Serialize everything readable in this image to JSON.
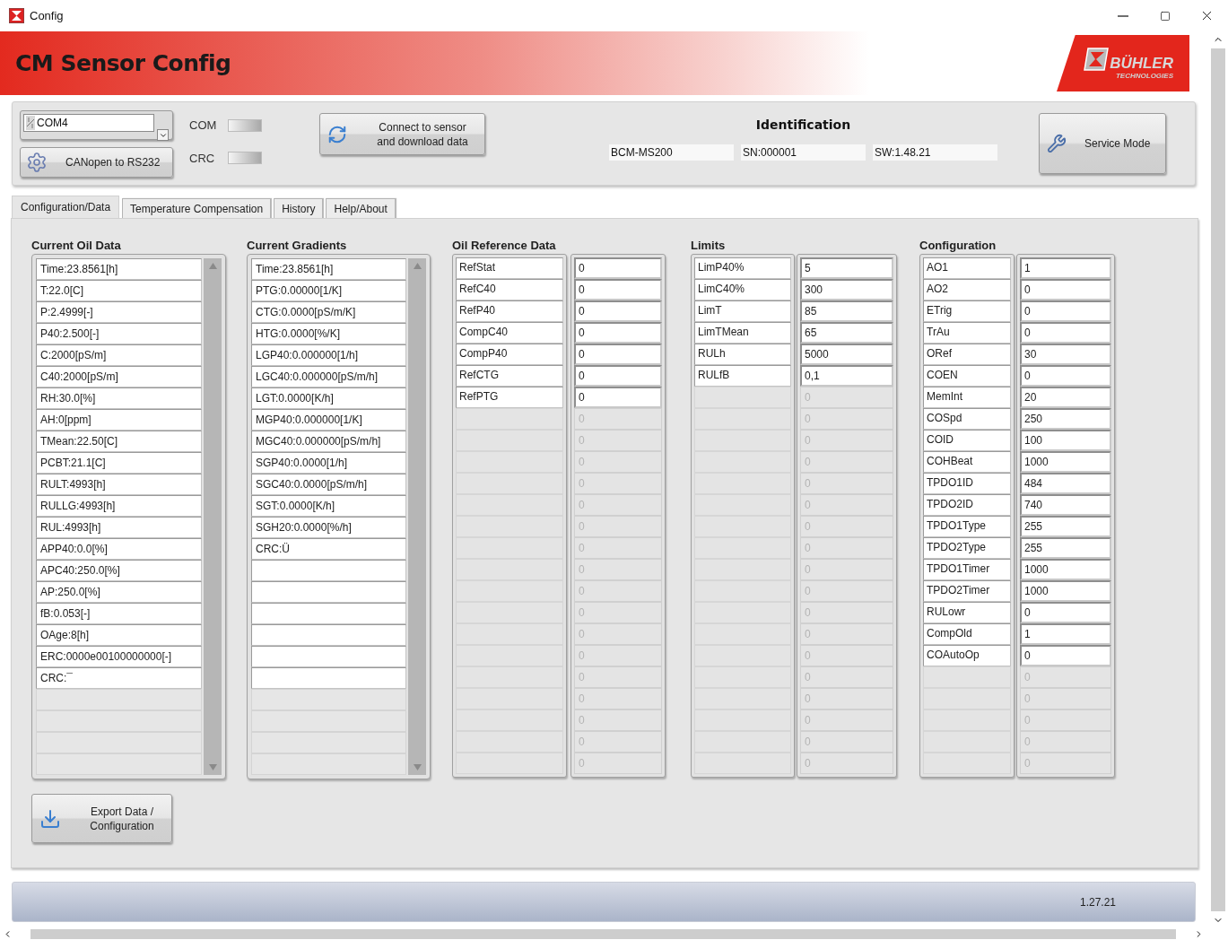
{
  "window": {
    "title": "Config"
  },
  "header": {
    "title": "CM Sensor Config",
    "logo": {
      "name": "BÜHLER",
      "tagline": "TECHNOLOGIES"
    }
  },
  "toolbar": {
    "port": {
      "value": "COM4"
    },
    "canopen_button": "CANopen to RS232",
    "indicators": [
      {
        "label": "COM",
        "on": false
      },
      {
        "label": "CRC",
        "on": false
      }
    ],
    "connect_button": "Connect to sensor and download data",
    "identification": {
      "title": "Identification",
      "fields": [
        "BCM-MS200",
        "SN:000001",
        "SW:1.48.21"
      ]
    },
    "service_button": "Service Mode"
  },
  "tabs": [
    {
      "label": "Configuration/Data",
      "selected": true
    },
    {
      "label": "Temperature Compensation",
      "selected": false
    },
    {
      "label": "History",
      "selected": false
    },
    {
      "label": "Help/About",
      "selected": false
    }
  ],
  "lists": [
    {
      "title": "Current Oil Data",
      "rows": [
        {
          "kind": "entry",
          "text": "Time:23.8561[h]"
        },
        {
          "kind": "entry",
          "text": "T:22.0[C]"
        },
        {
          "kind": "entry",
          "text": "P:2.4999[-]"
        },
        {
          "kind": "entry",
          "text": "P40:2.500[-]"
        },
        {
          "kind": "entry",
          "text": "C:2000[pS/m]"
        },
        {
          "kind": "entry",
          "text": "C40:2000[pS/m]"
        },
        {
          "kind": "entry",
          "text": "RH:30.0[%]"
        },
        {
          "kind": "entry",
          "text": "AH:0[ppm]"
        },
        {
          "kind": "entry",
          "text": "TMean:22.50[C]"
        },
        {
          "kind": "entry",
          "text": "PCBT:21.1[C]"
        },
        {
          "kind": "entry",
          "text": "RULT:4993[h]"
        },
        {
          "kind": "entry",
          "text": "RULLG:4993[h]"
        },
        {
          "kind": "entry",
          "text": "RUL:4993[h]"
        },
        {
          "kind": "entry",
          "text": "APP40:0.0[%]"
        },
        {
          "kind": "entry",
          "text": "APC40:250.0[%]"
        },
        {
          "kind": "entry",
          "text": "AP:250.0[%]"
        },
        {
          "kind": "entry",
          "text": "fB:0.053[-]"
        },
        {
          "kind": "entry",
          "text": "OAge:8[h]"
        },
        {
          "kind": "entry",
          "text": "ERC:0000e00100000000[-]"
        },
        {
          "kind": "entry",
          "text": "CRC:¯"
        }
      ]
    },
    {
      "title": "Current Gradients",
      "rows": [
        {
          "kind": "entry",
          "text": "Time:23.8561[h]"
        },
        {
          "kind": "entry",
          "text": "PTG:0.00000[1/K]"
        },
        {
          "kind": "entry",
          "text": "CTG:0.0000[pS/m/K]"
        },
        {
          "kind": "entry",
          "text": "HTG:0.0000[%/K]"
        },
        {
          "kind": "entry",
          "text": "LGP40:0.000000[1/h]"
        },
        {
          "kind": "entry",
          "text": "LGC40:0.000000[pS/m/h]"
        },
        {
          "kind": "entry",
          "text": "LGT:0.0000[K/h]"
        },
        {
          "kind": "entry",
          "text": "MGP40:0.000000[1/K]"
        },
        {
          "kind": "entry",
          "text": "MGC40:0.000000[pS/m/h]"
        },
        {
          "kind": "entry",
          "text": "SGP40:0.0000[1/h]"
        },
        {
          "kind": "entry",
          "text": "SGC40:0.0000[pS/m/h]"
        },
        {
          "kind": "entry",
          "text": "SGT:0.0000[K/h]"
        },
        {
          "kind": "entry",
          "text": "SGH20:0.0000[%/h]"
        },
        {
          "kind": "entry",
          "text": "CRC:Ü"
        },
        {
          "kind": "blank"
        },
        {
          "kind": "blank"
        },
        {
          "kind": "blank"
        },
        {
          "kind": "blank"
        },
        {
          "kind": "blank"
        },
        {
          "kind": "blank"
        }
      ]
    }
  ],
  "tables": [
    {
      "title": "Oil Reference Data",
      "rows": [
        {
          "name": "RefStat",
          "value": "0",
          "disabled": false
        },
        {
          "name": "RefC40",
          "value": "0",
          "disabled": false
        },
        {
          "name": "RefP40",
          "value": "0",
          "disabled": false
        },
        {
          "name": "CompC40",
          "value": "0",
          "disabled": false
        },
        {
          "name": "CompP40",
          "value": "0",
          "disabled": false
        },
        {
          "name": "RefCTG",
          "value": "0",
          "disabled": false
        },
        {
          "name": "RefPTG",
          "value": "0",
          "disabled": false
        },
        {
          "value": "0",
          "disabled": true
        },
        {
          "value": "0",
          "disabled": true
        },
        {
          "value": "0",
          "disabled": true
        },
        {
          "value": "0",
          "disabled": true
        },
        {
          "value": "0",
          "disabled": true
        },
        {
          "value": "0",
          "disabled": true
        },
        {
          "value": "0",
          "disabled": true
        },
        {
          "value": "0",
          "disabled": true
        },
        {
          "value": "0",
          "disabled": true
        },
        {
          "value": "0",
          "disabled": true
        },
        {
          "value": "0",
          "disabled": true
        },
        {
          "value": "0",
          "disabled": true
        },
        {
          "value": "0",
          "disabled": true
        },
        {
          "value": "0",
          "disabled": true
        },
        {
          "value": "0",
          "disabled": true
        },
        {
          "value": "0",
          "disabled": true
        },
        {
          "value": "0",
          "disabled": true
        }
      ]
    },
    {
      "title": "Limits",
      "rows": [
        {
          "name": "LimP40%",
          "value": "5",
          "disabled": false
        },
        {
          "name": "LimC40%",
          "value": "300",
          "disabled": false
        },
        {
          "name": "LimT",
          "value": "85",
          "disabled": false
        },
        {
          "name": "LimTMean",
          "value": "65",
          "disabled": false
        },
        {
          "name": "RULh",
          "value": "5000",
          "disabled": false
        },
        {
          "name": "RULfB",
          "value": "0,1",
          "disabled": false
        },
        {
          "value": "0",
          "disabled": true
        },
        {
          "value": "0",
          "disabled": true
        },
        {
          "value": "0",
          "disabled": true
        },
        {
          "value": "0",
          "disabled": true
        },
        {
          "value": "0",
          "disabled": true
        },
        {
          "value": "0",
          "disabled": true
        },
        {
          "value": "0",
          "disabled": true
        },
        {
          "value": "0",
          "disabled": true
        },
        {
          "value": "0",
          "disabled": true
        },
        {
          "value": "0",
          "disabled": true
        },
        {
          "value": "0",
          "disabled": true
        },
        {
          "value": "0",
          "disabled": true
        },
        {
          "value": "0",
          "disabled": true
        },
        {
          "value": "0",
          "disabled": true
        },
        {
          "value": "0",
          "disabled": true
        },
        {
          "value": "0",
          "disabled": true
        },
        {
          "value": "0",
          "disabled": true
        },
        {
          "value": "0",
          "disabled": true
        }
      ]
    },
    {
      "title": "Configuration",
      "rows": [
        {
          "name": "AO1",
          "value": "1",
          "disabled": false
        },
        {
          "name": "AO2",
          "value": "0",
          "disabled": false
        },
        {
          "name": "ETrig",
          "value": "0",
          "disabled": false
        },
        {
          "name": "TrAu",
          "value": "0",
          "disabled": false
        },
        {
          "name": "ORef",
          "value": "30",
          "disabled": false
        },
        {
          "name": "COEN",
          "value": "0",
          "disabled": false
        },
        {
          "name": "MemInt",
          "value": "20",
          "disabled": false
        },
        {
          "name": "COSpd",
          "value": "250",
          "disabled": false
        },
        {
          "name": "COID",
          "value": "100",
          "disabled": false
        },
        {
          "name": "COHBeat",
          "value": "1000",
          "disabled": false
        },
        {
          "name": "TPDO1ID",
          "value": "484",
          "disabled": false
        },
        {
          "name": "TPDO2ID",
          "value": "740",
          "disabled": false
        },
        {
          "name": "TPDO1Type",
          "value": "255",
          "disabled": false
        },
        {
          "name": "TPDO2Type",
          "value": "255",
          "disabled": false
        },
        {
          "name": "TPDO1Timer",
          "value": "1000",
          "disabled": false
        },
        {
          "name": "TPDO2Timer",
          "value": "1000",
          "disabled": false
        },
        {
          "name": "RULowr",
          "value": "0",
          "disabled": false
        },
        {
          "name": "CompOld",
          "value": "1",
          "disabled": false
        },
        {
          "name": "COAutoOp",
          "value": "0",
          "disabled": false
        },
        {
          "value": "0",
          "disabled": true
        },
        {
          "value": "0",
          "disabled": true
        },
        {
          "value": "0",
          "disabled": true
        },
        {
          "value": "0",
          "disabled": true
        },
        {
          "value": "0",
          "disabled": true
        }
      ]
    }
  ],
  "export_button": "Export Data / Configuration",
  "status_bar": {
    "version": "1.27.21"
  }
}
